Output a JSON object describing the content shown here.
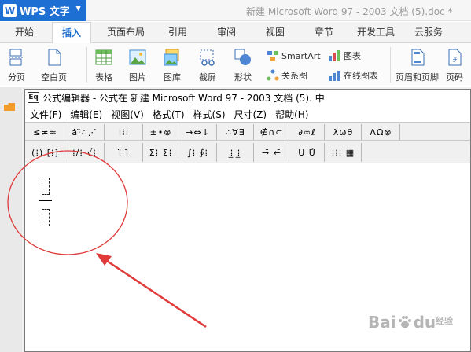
{
  "app": {
    "wps_label": "WPS 文字",
    "logo_letter": "W",
    "document_title": "新建 Microsoft Word 97 - 2003 文档 (5).doc *"
  },
  "ribbon_tabs": [
    {
      "label": "开始"
    },
    {
      "label": "插入",
      "active": true
    },
    {
      "label": "页面布局"
    },
    {
      "label": "引用"
    },
    {
      "label": "审阅"
    },
    {
      "label": "视图"
    },
    {
      "label": "章节"
    },
    {
      "label": "开发工具"
    },
    {
      "label": "云服务"
    }
  ],
  "ribbon_buttons": {
    "page_break": "分页",
    "blank_page": "空白页",
    "table": "表格",
    "picture": "图片",
    "gallery": "图库",
    "screenshot": "截屏",
    "shape": "形状",
    "smartart": "SmartArt",
    "chart": "图表",
    "relation_chart": "关系图",
    "online_chart": "在线图表",
    "header_footer": "页眉和页脚",
    "page_number": "页码"
  },
  "equation_editor": {
    "app_icon_text": "Eq",
    "title": "公式编辑器 - 公式在 新建 Microsoft Word 97 - 2003 文档 (5). 中",
    "menus": [
      "文件(F)",
      "编辑(E)",
      "视图(V)",
      "格式(T)",
      "样式(S)",
      "尺寸(Z)",
      "帮助(H)"
    ],
    "palette_row1": [
      "≤≠≈",
      "ȧ⋅̈∴⋰",
      "⁞⁞⁞",
      "±•⊗",
      "→⇔↓",
      "∴∀∃",
      "∉∩⊂",
      "∂∞ℓ",
      "λωθ",
      "ΛΩ⊗"
    ],
    "palette_row2": [
      "(⁞) [⁞]",
      "⁞/⁞ √⁞",
      "⁞̈ ⁞̄",
      "Σ⁞ Σ⁞",
      "∫⁞ ∮⁞",
      "⁞̲ ⁞̳",
      "→̄ ←̄",
      "Ū Ů",
      "⁞⁞⁞ ▦"
    ]
  },
  "watermark": {
    "text_bai": "Bai",
    "text_du": "du",
    "sub": "经验"
  },
  "colors": {
    "accent": "#1e6fd4",
    "annotation": "#e03a3a"
  }
}
